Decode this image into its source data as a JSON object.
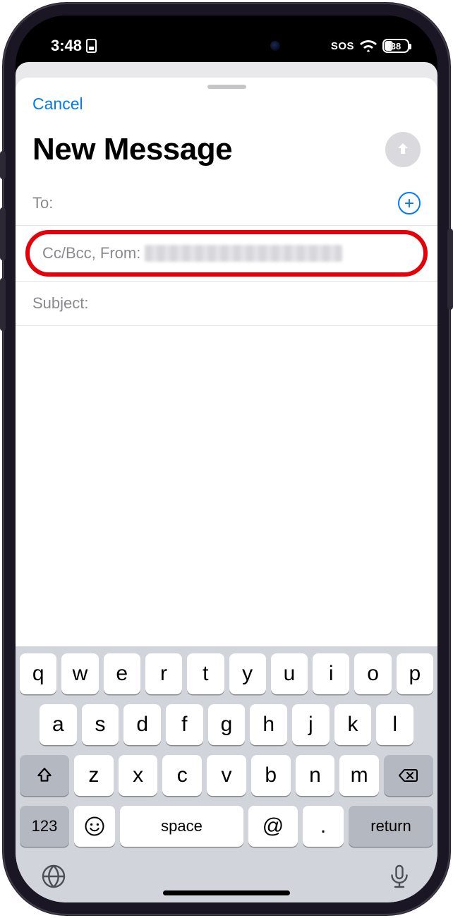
{
  "status": {
    "time": "3:48",
    "sos": "SOS",
    "battery_percent": "38"
  },
  "compose": {
    "cancel": "Cancel",
    "title": "New Message",
    "to_label": "To:",
    "ccbcc_label": "Cc/Bcc, From:",
    "subject_label": "Subject:"
  },
  "keyboard": {
    "row1": [
      "q",
      "w",
      "e",
      "r",
      "t",
      "y",
      "u",
      "i",
      "o",
      "p"
    ],
    "row2": [
      "a",
      "s",
      "d",
      "f",
      "g",
      "h",
      "j",
      "k",
      "l"
    ],
    "row3": [
      "z",
      "x",
      "c",
      "v",
      "b",
      "n",
      "m"
    ],
    "numbers": "123",
    "space": "space",
    "at": "@",
    "period": ".",
    "return": "return"
  }
}
